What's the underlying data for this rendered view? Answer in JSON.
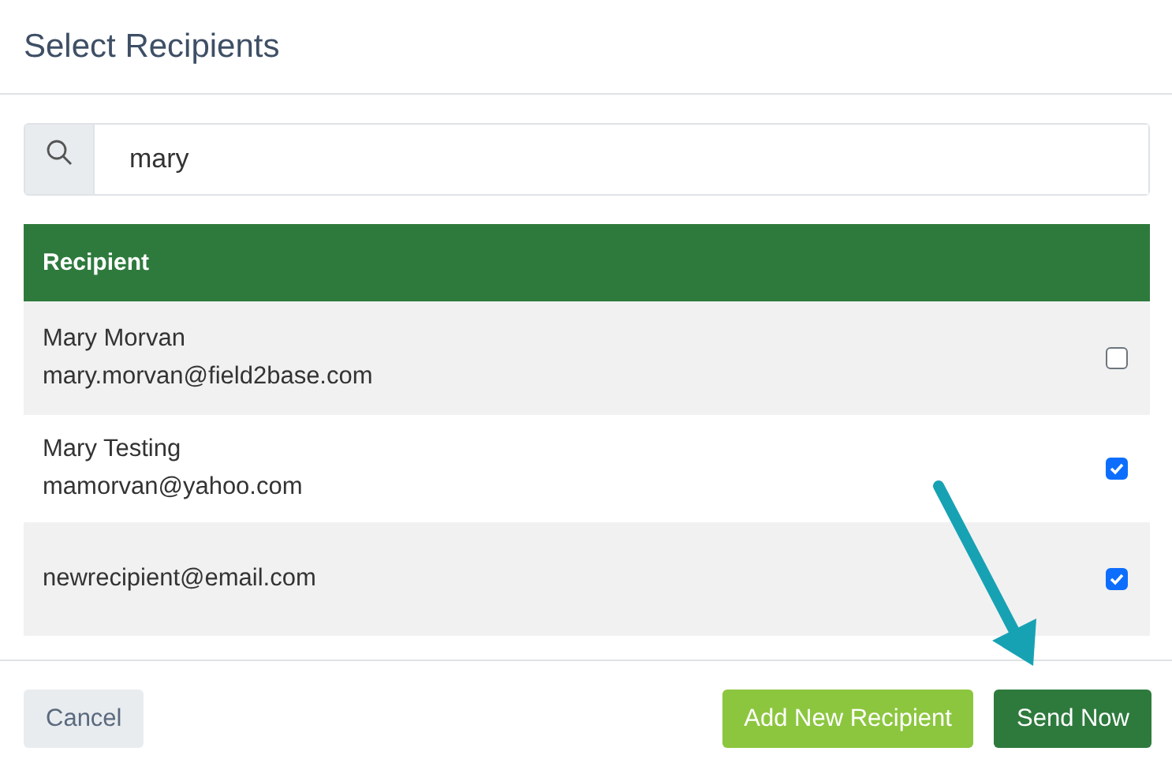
{
  "dialog": {
    "title": "Select Recipients"
  },
  "search": {
    "value": "mary"
  },
  "table": {
    "columns": [
      "Recipient"
    ],
    "rows": [
      {
        "name": "Mary Morvan",
        "email": "mary.morvan@field2base.com",
        "checked": false
      },
      {
        "name": "Mary Testing",
        "email": "mamorvan@yahoo.com",
        "checked": true
      },
      {
        "email": "newrecipient@email.com",
        "checked": true
      }
    ]
  },
  "buttons": [
    {
      "label": "Cancel",
      "kind": "secondary"
    },
    {
      "label": "Add New Recipient",
      "kind": "accent"
    },
    {
      "label": "Send Now",
      "kind": "primary"
    }
  ]
}
